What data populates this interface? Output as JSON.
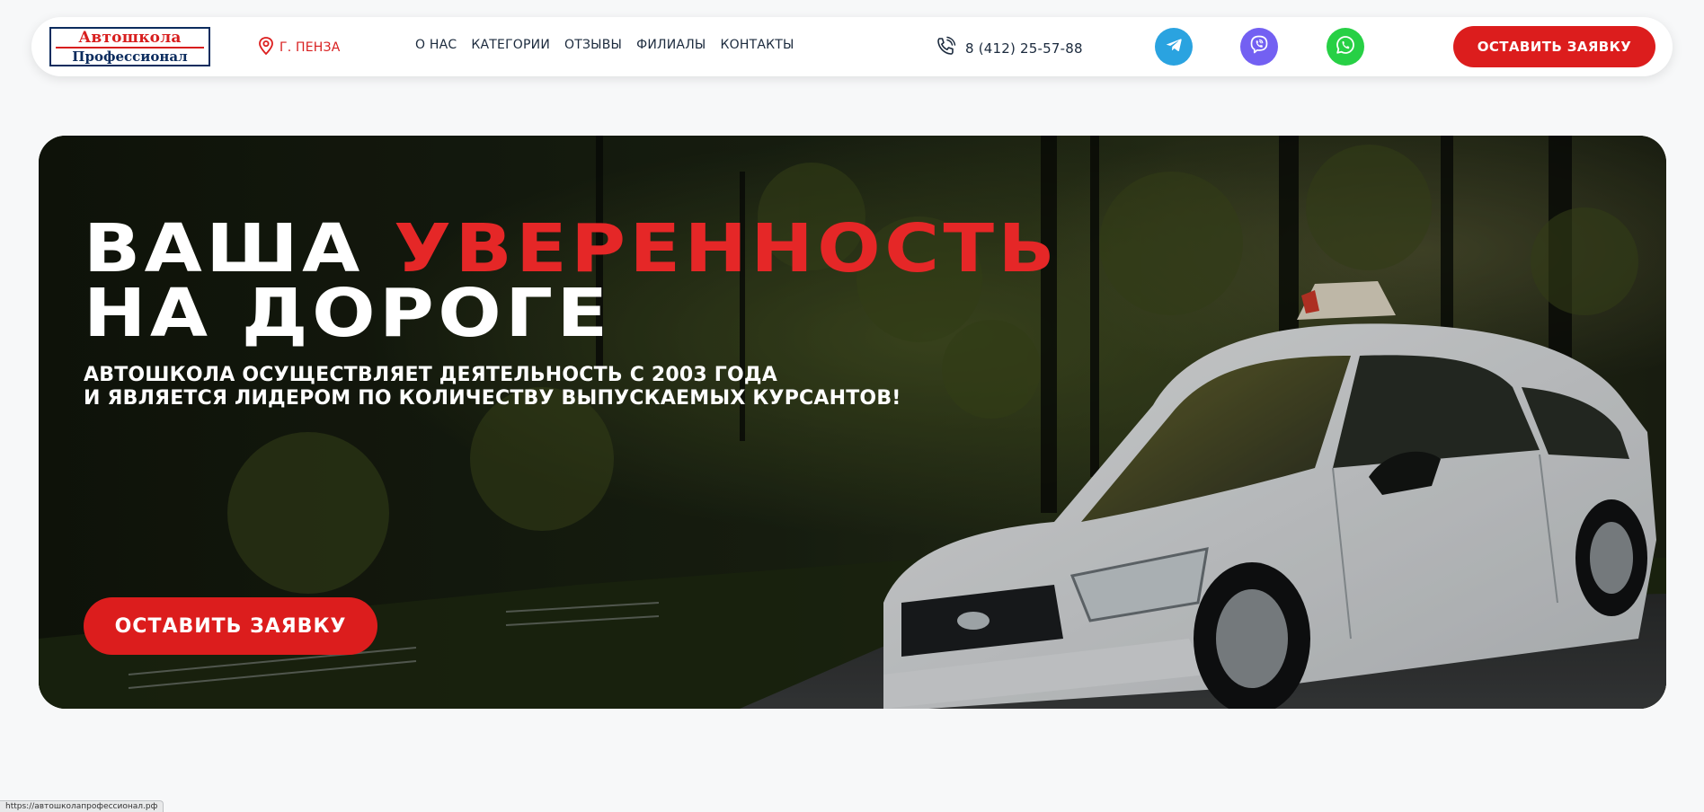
{
  "header": {
    "logo": {
      "line1": "Автошкола",
      "line2": "Профессионал"
    },
    "city": "г. Пенза",
    "nav": [
      {
        "label": "О нас"
      },
      {
        "label": "Категории"
      },
      {
        "label": "Отзывы"
      },
      {
        "label": "Филиалы"
      },
      {
        "label": "Контакты"
      }
    ],
    "phone": "8 (412) 25-57-88",
    "social": [
      {
        "icon": "telegram-icon",
        "color": "#2aa3e0"
      },
      {
        "icon": "viber-icon",
        "color": "#7360f2"
      },
      {
        "icon": "whatsapp-icon",
        "color": "#27d045"
      }
    ],
    "cta_label": "Оставить заявку"
  },
  "hero": {
    "title_part1": "Ваша",
    "title_accent": "уверенность",
    "title_line2": "на дороге",
    "subtitle_line1": "Автошкола осуществляет деятельность с 2003 года",
    "subtitle_line2": "и является лидером по количеству выпускаемых курсантов!",
    "cta_label": "Оставить заявку"
  },
  "status_bar": {
    "url": "https://автошколапрофессионал.рф"
  },
  "colors": {
    "accent": "#dc1d1d",
    "text_dark": "#1b2a3d",
    "background": "#f7f8f9"
  }
}
